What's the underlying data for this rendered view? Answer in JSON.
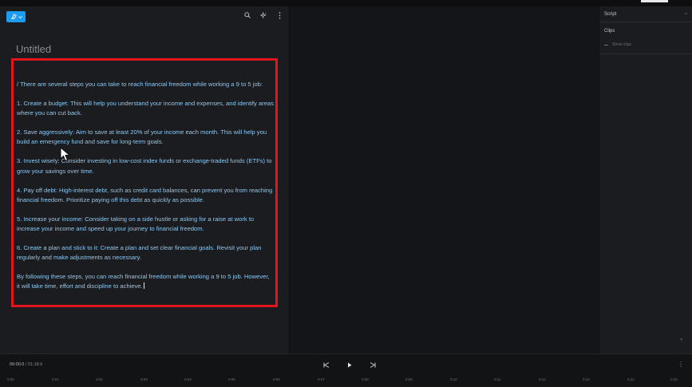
{
  "app": {
    "toolbar": {
      "icons": [
        "search-icon",
        "sparkle-icon",
        "more-vertical-icon"
      ]
    },
    "brand_color": "#1d9bf0"
  },
  "editor": {
    "title": "Untitled",
    "paragraphs": [
      "/ There are several steps you can take to reach financial freedom while working a 9 to 5 job:",
      "1. Create a budget: This will help you understand your income and expenses, and identify areas where you can cut back.",
      "2. Save aggressively: Aim to save at least 20% of your income each month. This will help you build an emergency fund and save for long-term goals.",
      "3. Invest wisely: Consider investing in low-cost index funds or exchange-traded funds (ETFs) to grow your savings over time.",
      "4. Pay off debt: High-interest debt, such as credit card balances, can prevent you from reaching financial freedom. Prioritize paying off this debt as quickly as possible.",
      "5. Increase your income: Consider taking on a side hustle or asking for a raise at work to increase your income and speed up your journey to financial freedom.",
      "6. Create a plan and stick to it: Create a plan and set clear financial goals. Revisit your plan regularly and make adjustments as necessary.",
      "By following these steps, you can reach financial freedom while working a 9 to 5 job. However, it will take time, effort and discipline to achieve."
    ],
    "highlight_color": "#e3141c"
  },
  "right_panel": {
    "title": "Script",
    "more": "···",
    "section": "Clips",
    "show_clips": "Show clips",
    "help": "?"
  },
  "player": {
    "current_time": "00:00.0",
    "separator": " / ",
    "total_time": "01:18.6",
    "more": "⋮"
  },
  "timeline": {
    "ticks": [
      "0:00",
      "0:01",
      "0:02",
      "0:03",
      "0:04",
      "0:05",
      "0:06",
      "0:07",
      "0:08",
      "0:09",
      "0:10",
      "0:11",
      "0:12",
      "0:13",
      "0:14",
      "0:15"
    ]
  }
}
